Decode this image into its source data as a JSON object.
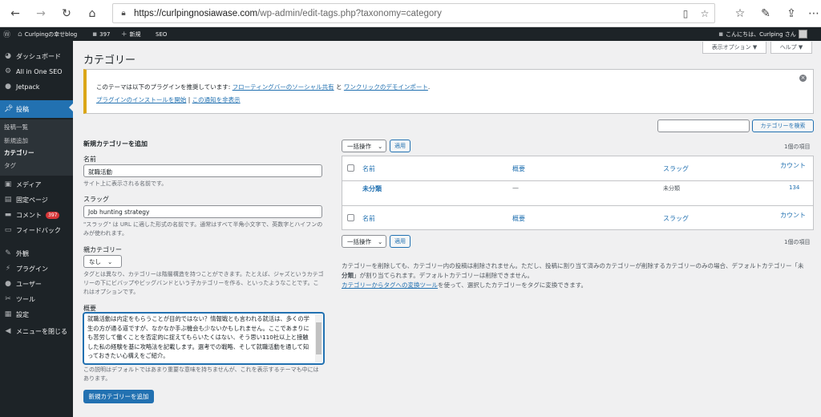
{
  "browser": {
    "url_host": "https://curlpingnosiawase.com",
    "url_path": "/wp-admin/edit-tags.php?taxonomy=category"
  },
  "adminbar": {
    "site_name": "Curlpingの幸せblog",
    "comments_count": "397",
    "new_label": "新規",
    "seo_label": "SEO",
    "greeting": "こんにちは、Curlping さん"
  },
  "sidebar": {
    "items": [
      {
        "label": "ダッシュボード",
        "icon": "dashboard-icon"
      },
      {
        "label": "All in One SEO",
        "icon": "seo-icon"
      },
      {
        "label": "Jetpack",
        "icon": "jetpack-icon"
      },
      {
        "label": "投稿",
        "icon": "pin-icon"
      },
      {
        "label": "メディア",
        "icon": "media-icon"
      },
      {
        "label": "固定ページ",
        "icon": "page-icon"
      },
      {
        "label": "コメント",
        "icon": "comment-icon",
        "badge": "397"
      },
      {
        "label": "フィードバック",
        "icon": "feedback-icon"
      },
      {
        "label": "外観",
        "icon": "appearance-icon"
      },
      {
        "label": "プラグイン",
        "icon": "plugin-icon"
      },
      {
        "label": "ユーザー",
        "icon": "user-icon"
      },
      {
        "label": "ツール",
        "icon": "tool-icon"
      },
      {
        "label": "設定",
        "icon": "settings-icon"
      },
      {
        "label": "メニューを閉じる",
        "icon": "collapse-icon"
      }
    ],
    "submenu": [
      "投稿一覧",
      "新規追加",
      "カテゴリー",
      "タグ"
    ]
  },
  "page": {
    "title": "カテゴリー",
    "screen_options": "表示オプション ▼",
    "help": "ヘルプ ▼"
  },
  "notice": {
    "text1_prefix": "このテーマは以下のプラグインを推奨しています: ",
    "link1": "フローティングバーのソーシャル共有",
    "text1_mid": " と ",
    "link2": "ワンクリックのデモインポート",
    "text1_suffix": ".",
    "link3": "プラグインのインストールを開始",
    "sep": " | ",
    "link4": "この通知を非表示"
  },
  "search": {
    "button": "カテゴリーを検索"
  },
  "form": {
    "heading": "新規カテゴリーを追加",
    "name_label": "名前",
    "name_value": "就職活動",
    "name_help": "サイト上に表示される名前です。",
    "slug_label": "スラッグ",
    "slug_value": "Job hunting strategy",
    "slug_help": "\"スラッグ\" は URL に適した形式の名前です。通常はすべて半角小文字で、英数字とハイフンのみが使われます。",
    "parent_label": "親カテゴリー",
    "parent_value": "なし",
    "parent_help": "タグとは異なり、カテゴリーは階層構造を持つことができます。たとえば、ジャズというカテゴリーの下にビバップやビッグバンドという子カテゴリーを作る、といったようなことです。これはオプションです。",
    "desc_label": "概要",
    "desc_value": "就職活動は内定をもらうことが目的ではない？情報戦とも言われる就活は、多くの学生の方が通る道ですが、なかなか手ぶ機会も少ないかもしれません。ここであまりにも苦労して働くことを否定的に捉えてもらいたくはない、そう思い110社以上と接触した私の経験を基に攻略法を記載します。選考での戦略、そして就職活動を通して知っておきたい心構えをご紹介。",
    "desc_help": "この説明はデフォルトではあまり重要な意味を持ちませんが、これを表示するテーマも中にはあります。",
    "submit": "新規カテゴリーを追加"
  },
  "table": {
    "bulk_label": "一括操作",
    "apply": "適用",
    "items_count": "1個の項目",
    "columns": [
      "名前",
      "概要",
      "スラッグ",
      "カウント"
    ],
    "rows": [
      {
        "name": "未分類",
        "description": "—",
        "slug": "未分類",
        "count": "134"
      }
    ]
  },
  "footer_note": {
    "line1": "カテゴリーを削除しても、カテゴリー内の投稿は削除されません。ただし、投稿に割り当て済みのカテゴリーが削除するカテゴリーのみの場合、デフォルトカテゴリー「未",
    "line2_bold": "分類",
    "line2_rest": "」が割り当てられます。デフォルトカテゴリーは削除できません。",
    "link": "カテゴリーからタグへの変換ツール",
    "line3_rest": "を使って、選択したカテゴリーをタグに変換できます。"
  }
}
